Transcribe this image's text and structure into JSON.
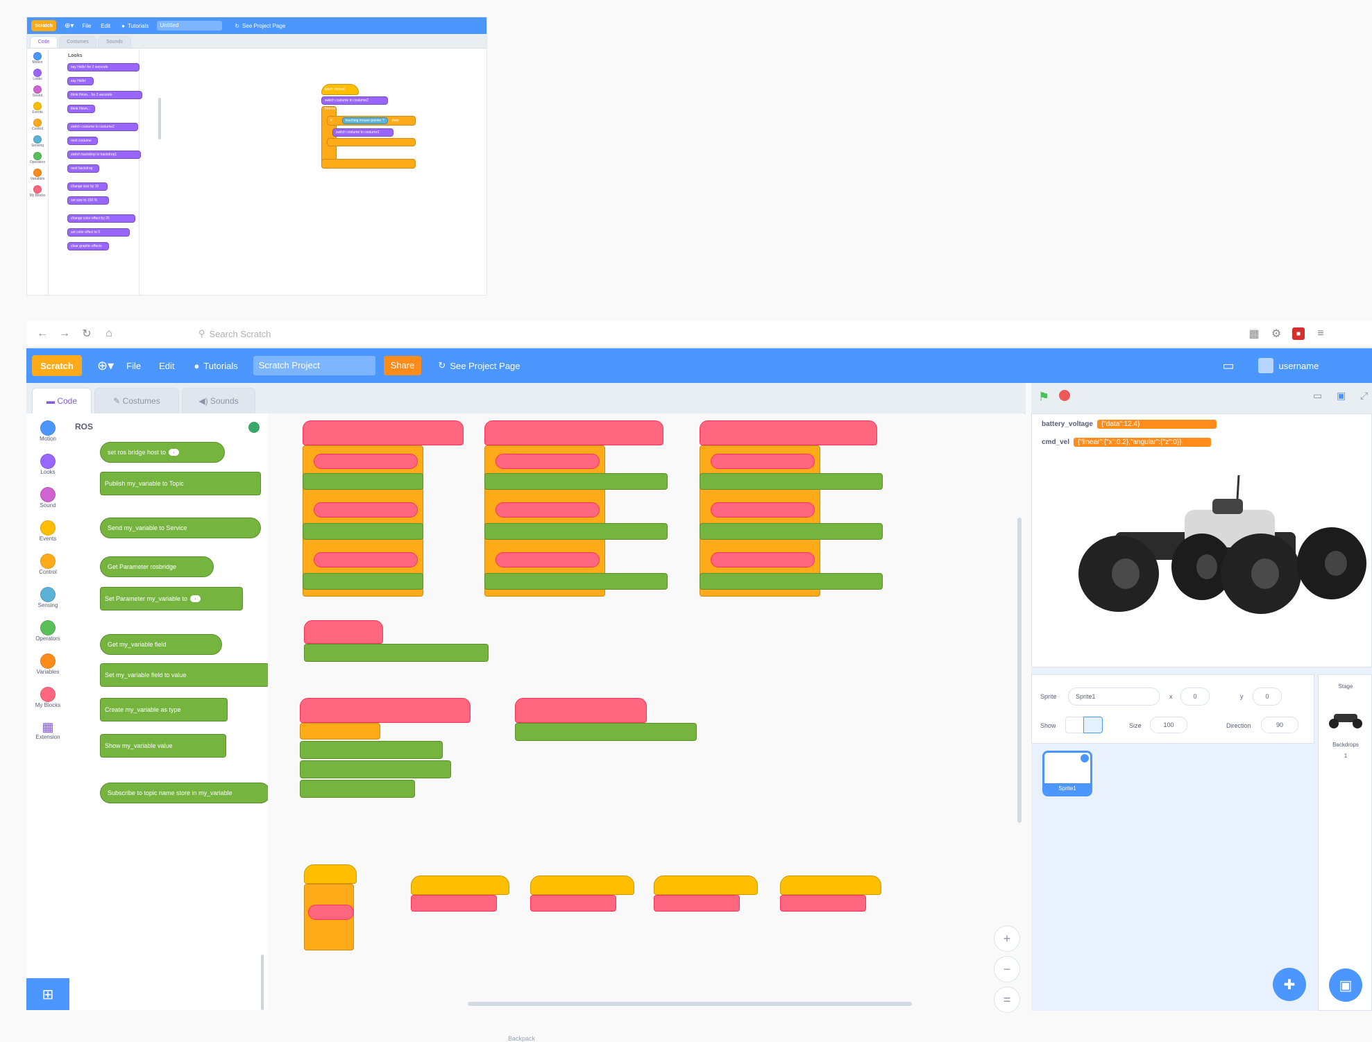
{
  "mini": {
    "menubar": {
      "logo": "Scratch",
      "file": "File",
      "edit": "Edit",
      "tutorials": "Tutorials",
      "project_title": "Untitled",
      "see_project_page": "See Project Page"
    },
    "tabs": [
      "Code",
      "Costumes",
      "Sounds"
    ],
    "categories": [
      "Motion",
      "Looks",
      "Sound",
      "Events",
      "Control",
      "Sensing",
      "Operators",
      "Variables",
      "My Blocks"
    ],
    "palette_heading": "Looks",
    "palette_blocks": [
      "say Hello! for 2 seconds",
      "say Hello!",
      "think Hmm... for 2 seconds",
      "think Hmm...",
      "switch costume to costume2",
      "next costume",
      "switch backdrop to backdrop1",
      "next backdrop",
      "change size by 10",
      "set size to 100 %",
      "change color effect by 25",
      "set color effect to 0",
      "clear graphic effects"
    ],
    "script": {
      "hat": "when clicked",
      "switch": "switch costume to costume2",
      "forever": "forever",
      "if": "if",
      "touching": "touching mouse-pointer ?",
      "then": "then",
      "switch2": "switch costume to costume1"
    }
  },
  "browser": {
    "url_placeholder": "Search Scratch"
  },
  "main": {
    "menubar": {
      "logo": "Scratch",
      "file": "File",
      "edit": "Edit",
      "tutorials": "Tutorials",
      "project_title": "Scratch Project",
      "share": "Share",
      "see_project_page": "See Project Page",
      "username": "username"
    },
    "tabs": [
      "Code",
      "Costumes",
      "Sounds"
    ],
    "categories": [
      "Motion",
      "Looks",
      "Sound",
      "Events",
      "Control",
      "Sensing",
      "Operators",
      "Variables",
      "My Blocks",
      "Extension"
    ],
    "palette_heading": "ROS",
    "palette_blocks": [
      "set ros bridge host to",
      "Publish my_variable to Topic",
      "Send my_variable to Service",
      "Get Parameter rosbridge",
      "Set Parameter my_variable to",
      "Get my_variable field",
      "Set my_variable field to value",
      "Create my_variable as type",
      "Show my_variable value",
      "Subscribe to topic name store in my_variable"
    ],
    "stage": {
      "monitors": [
        {
          "label": "battery_voltage",
          "value": "{\"data\":12.4}"
        },
        {
          "label": "cmd_vel",
          "value": "{\"linear\":{\"x\":0.2},\"angular\":{\"z\":0}}"
        }
      ]
    },
    "sprite_info": {
      "sprite_label": "Sprite",
      "sprite_name": "Sprite1",
      "x_label": "x",
      "x_value": "0",
      "y_label": "y",
      "y_value": "0",
      "show_label": "Show",
      "size_label": "Size",
      "size_value": "100",
      "direction_label": "Direction",
      "direction_value": "90"
    },
    "sprite_tile": "Sprite1",
    "stage_panel": {
      "title": "Stage",
      "backdrops_label": "Backdrops",
      "backdrops_count": "1"
    },
    "zoom": [
      "+",
      "−",
      "="
    ],
    "bottom_label": "Backpack"
  },
  "colors": {
    "menubar": "#4c97ff",
    "accent": "#855cd6",
    "events": "#ffbf00",
    "ros_green": "#75b53f",
    "ros_red": "#ff6680",
    "control": "#ffab19"
  }
}
